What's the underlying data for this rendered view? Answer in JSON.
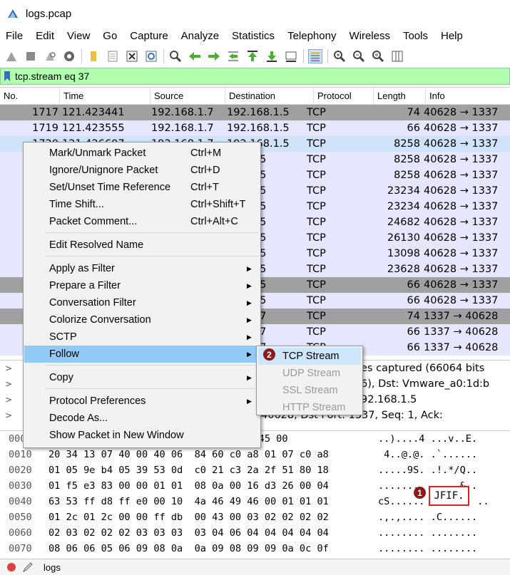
{
  "window": {
    "title": "logs.pcap"
  },
  "menubar": [
    "File",
    "Edit",
    "View",
    "Go",
    "Capture",
    "Analyze",
    "Statistics",
    "Telephony",
    "Wireless",
    "Tools",
    "Help"
  ],
  "toolbar_icons": [
    "shark-start-icon",
    "stop-icon",
    "restart-icon",
    "options-gear-icon",
    "open-folder-icon",
    "file-set-icon",
    "close-file-icon",
    "reload-icon",
    "find-icon",
    "back-arrow-icon",
    "forward-arrow-icon",
    "goto-packet-icon",
    "first-packet-icon",
    "last-packet-icon",
    "autoscroll-icon",
    "colorize-icon",
    "zoom-in-icon",
    "zoom-out-icon",
    "normal-size-icon",
    "resize-columns-icon"
  ],
  "filter": {
    "text": "tcp.stream eq 37",
    "bg": "#afffaf"
  },
  "columns": [
    "No.",
    "Time",
    "Source",
    "Destination",
    "Protocol",
    "Length",
    "Info"
  ],
  "packets": [
    {
      "no": "1717",
      "time": "121.423441",
      "src": "192.168.1.7",
      "dst": "192.168.1.5",
      "proto": "TCP",
      "len": "74",
      "info": "40628 → 1337",
      "style": "gray"
    },
    {
      "no": "1719",
      "time": "121.423555",
      "src": "192.168.1.7",
      "dst": "192.168.1.5",
      "proto": "TCP",
      "len": "66",
      "info": "40628 → 1337",
      "style": "lav"
    },
    {
      "no": "1720",
      "time": "121.426607",
      "src": "192.168.1.7",
      "dst": "192.168.1.5",
      "proto": "TCP",
      "len": "8258",
      "info": "40628 → 1337",
      "style": "sel"
    },
    {
      "no": "",
      "time": "",
      "src": "",
      "dst": "168.1.5",
      "proto": "TCP",
      "len": "8258",
      "info": "40628 → 1337",
      "style": "lav"
    },
    {
      "no": "",
      "time": "",
      "src": "",
      "dst": "168.1.5",
      "proto": "TCP",
      "len": "8258",
      "info": "40628 → 1337",
      "style": "lav"
    },
    {
      "no": "",
      "time": "",
      "src": "",
      "dst": "168.1.5",
      "proto": "TCP",
      "len": "23234",
      "info": "40628 → 1337",
      "style": "lav"
    },
    {
      "no": "",
      "time": "",
      "src": "",
      "dst": "168.1.5",
      "proto": "TCP",
      "len": "23234",
      "info": "40628 → 1337",
      "style": "lav"
    },
    {
      "no": "",
      "time": "",
      "src": "",
      "dst": "168.1.5",
      "proto": "TCP",
      "len": "24682",
      "info": "40628 → 1337",
      "style": "lav"
    },
    {
      "no": "",
      "time": "",
      "src": "",
      "dst": "168.1.5",
      "proto": "TCP",
      "len": "26130",
      "info": "40628 → 1337",
      "style": "lav"
    },
    {
      "no": "",
      "time": "",
      "src": "",
      "dst": "168.1.5",
      "proto": "TCP",
      "len": "13098",
      "info": "40628 → 1337",
      "style": "lav"
    },
    {
      "no": "",
      "time": "",
      "src": "",
      "dst": "168.1.5",
      "proto": "TCP",
      "len": "23628",
      "info": "40628 → 1337",
      "style": "lav"
    },
    {
      "no": "",
      "time": "",
      "src": "",
      "dst": "168.1.5",
      "proto": "TCP",
      "len": "66",
      "info": "40628 → 1337",
      "style": "gray"
    },
    {
      "no": "",
      "time": "",
      "src": "",
      "dst": "168.1.5",
      "proto": "TCP",
      "len": "66",
      "info": "40628 → 1337",
      "style": "lav"
    },
    {
      "no": "",
      "time": "",
      "src": "",
      "dst": "168.1.7",
      "proto": "TCP",
      "len": "74",
      "info": "1337 → 40628",
      "style": "gray"
    },
    {
      "no": "",
      "time": "",
      "src": "",
      "dst": "168.1.7",
      "proto": "TCP",
      "len": "66",
      "info": "1337 → 40628",
      "style": "lav"
    },
    {
      "no": "",
      "time": "",
      "src": "",
      "dst": "168.1.7",
      "proto": "TCP",
      "len": "66",
      "info": "1337 → 40628",
      "style": "lav"
    }
  ],
  "details": [
    {
      "text": "es captured (66064 bits"
    },
    {
      "text": "6), Dst: Vmware_a0:1d:b"
    },
    {
      "text": "92.168.1.5"
    },
    {
      "text": "40628, Dst Port: 1337, Seq: 1, Ack:"
    }
  ],
  "hex": [
    {
      "off": "0000",
      "bytes": "                           76 08 00 45 00",
      "asc": "..)....4 ...v..E."
    },
    {
      "off": "0010",
      "bytes": "20 34 13 07 40 00 40 06  84 60 c0 a8 01 07 c0 a8",
      "asc": " 4..@.@. .`......"
    },
    {
      "off": "0020",
      "bytes": "01 05 9e b4 05 39 53 0d  c0 21 c3 2a 2f 51 80 18",
      "asc": ".....9S. .!.*/Q.."
    },
    {
      "off": "0030",
      "bytes": "01 f5 e3 83 00 00 01 01  08 0a 00 16 d3 26 00 04",
      "asc": "........ .....&.."
    },
    {
      "off": "0040",
      "bytes": "63 53 ff d8 ff e0 00 10  4a 46 49 46 00 01 01 01",
      "asc": "cS......         .."
    },
    {
      "off": "0050",
      "bytes": "01 2c 01 2c 00 00 ff db  00 43 00 03 02 02 02 02",
      "asc": ".,.,.... .C......"
    },
    {
      "off": "0060",
      "bytes": "02 03 02 02 02 03 03 03  03 04 06 04 04 04 04 04",
      "asc": "........ ........"
    },
    {
      "off": "0070",
      "bytes": "08 06 06 05 06 09 08 0a  0a 09 08 09 09 0a 0c 0f",
      "asc": "........ ........"
    }
  ],
  "jfif_highlight": "JFIF.",
  "context_menu": {
    "items": [
      {
        "label": "Mark/Unmark Packet",
        "shortcut": "Ctrl+M"
      },
      {
        "label": "Ignore/Unignore Packet",
        "shortcut": "Ctrl+D"
      },
      {
        "label": "Set/Unset Time Reference",
        "shortcut": "Ctrl+T"
      },
      {
        "label": "Time Shift...",
        "shortcut": "Ctrl+Shift+T"
      },
      {
        "label": "Packet Comment...",
        "shortcut": "Ctrl+Alt+C"
      },
      {
        "label": "Edit Resolved Name"
      },
      {
        "label": "Apply as Filter"
      },
      {
        "label": "Prepare a Filter"
      },
      {
        "label": "Conversation Filter"
      },
      {
        "label": "Colorize Conversation"
      },
      {
        "label": "SCTP"
      },
      {
        "label": "Follow"
      },
      {
        "label": "Copy"
      },
      {
        "label": "Protocol Preferences"
      },
      {
        "label": "Decode As..."
      },
      {
        "label": "Show Packet in New Window"
      }
    ]
  },
  "follow_submenu": {
    "items": [
      {
        "label": "TCP Stream",
        "enabled": true
      },
      {
        "label": "UDP Stream",
        "enabled": false
      },
      {
        "label": "SSL Stream",
        "enabled": false
      },
      {
        "label": "HTTP Stream",
        "enabled": false
      }
    ]
  },
  "badges": {
    "step1": "1",
    "step2": "2"
  },
  "status": {
    "file": "logs"
  },
  "colors": {
    "selected_row": "#cfe3fa",
    "gray_row": "#a0a0a0",
    "lavender_row": "#e7e6ff",
    "menu_highlight": "#91c9f7",
    "badge": "#8b1a1a",
    "jfif_box_border": "#e02020"
  }
}
